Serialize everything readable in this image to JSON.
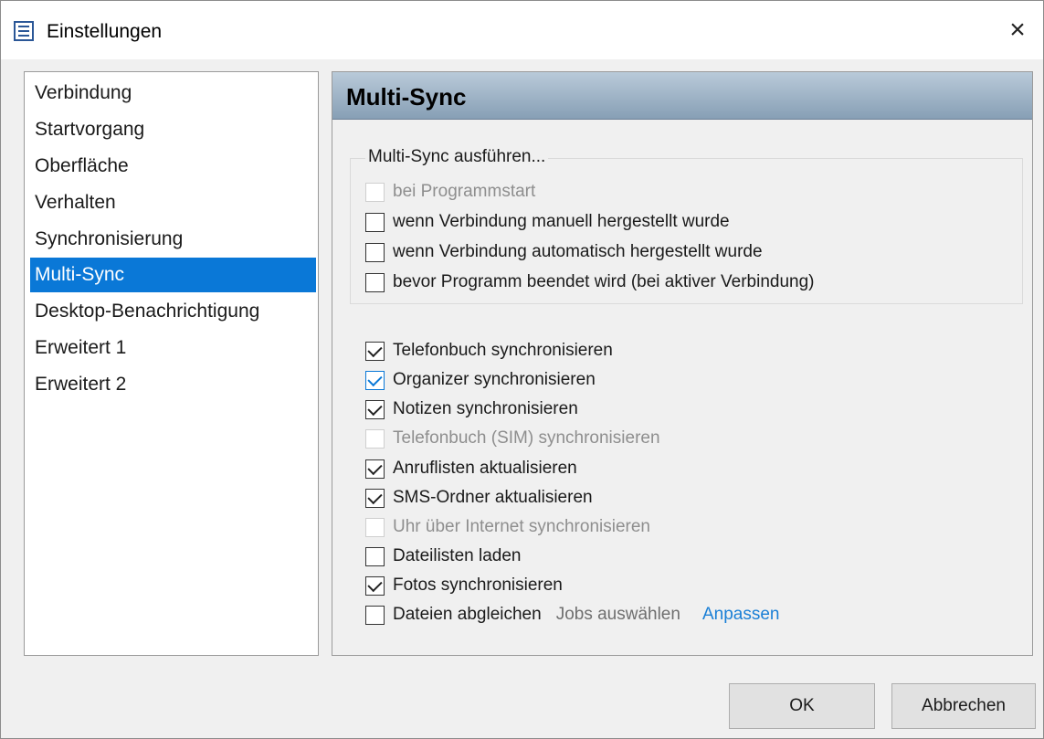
{
  "window": {
    "title": "Einstellungen",
    "close_glyph": "×"
  },
  "sidebar": {
    "items": [
      {
        "label": "Verbindung"
      },
      {
        "label": "Startvorgang"
      },
      {
        "label": "Oberfläche"
      },
      {
        "label": "Verhalten"
      },
      {
        "label": "Synchronisierung"
      },
      {
        "label": "Multi-Sync",
        "selected": true
      },
      {
        "label": "Desktop-Benachrichtigung"
      },
      {
        "label": "Erweitert 1"
      },
      {
        "label": "Erweitert 2"
      }
    ]
  },
  "panel": {
    "title": "Multi-Sync",
    "group": {
      "legend": "Multi-Sync ausführen...",
      "options": [
        {
          "label": "bei Programmstart",
          "checked": false,
          "disabled": true
        },
        {
          "label": "wenn Verbindung manuell hergestellt wurde",
          "checked": false,
          "disabled": false
        },
        {
          "label": "wenn Verbindung automatisch hergestellt wurde",
          "checked": false,
          "disabled": false
        },
        {
          "label": "bevor Programm beendet wird (bei aktiver Verbindung)",
          "checked": false,
          "disabled": false
        }
      ]
    },
    "sync_options": [
      {
        "label": "Telefonbuch synchronisieren",
        "checked": true,
        "disabled": false
      },
      {
        "label": "Organizer synchronisieren",
        "checked": true,
        "disabled": false,
        "hover": true
      },
      {
        "label": "Notizen synchronisieren",
        "checked": true,
        "disabled": false
      },
      {
        "label": "Telefonbuch (SIM) synchronisieren",
        "checked": false,
        "disabled": true
      },
      {
        "label": "Anruflisten aktualisieren",
        "checked": true,
        "disabled": false
      },
      {
        "label": "SMS-Ordner aktualisieren",
        "checked": true,
        "disabled": false
      },
      {
        "label": "Uhr über Internet synchronisieren",
        "checked": false,
        "disabled": true
      },
      {
        "label": "Dateilisten laden",
        "checked": false,
        "disabled": false
      },
      {
        "label": "Fotos synchronisieren",
        "checked": true,
        "disabled": false
      },
      {
        "label": "Dateien abgleichen",
        "checked": false,
        "disabled": false
      }
    ],
    "jobs_label": "Jobs auswählen",
    "customize_link": "Anpassen"
  },
  "buttons": {
    "ok": "OK",
    "cancel": "Abbrechen"
  },
  "colors": {
    "selection": "#0a78d7",
    "link": "#1a7fd6",
    "header_gradient_top": "#b9cad9",
    "header_gradient_bottom": "#879fb5"
  },
  "icons": {
    "app": "settings-list-icon",
    "close": "close-icon",
    "check": "checkmark-icon"
  }
}
